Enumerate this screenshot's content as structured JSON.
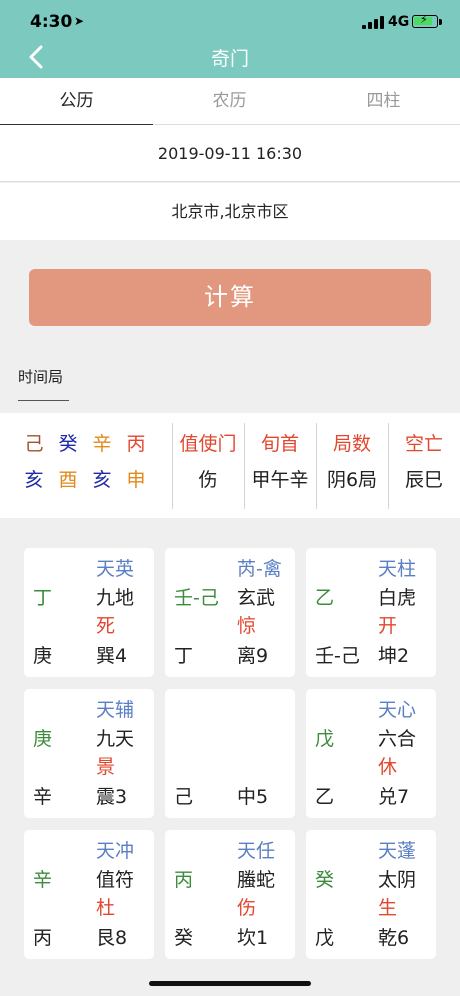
{
  "status_bar": {
    "time": "4:30",
    "location_icon": "location-arrow-icon",
    "network": "4G",
    "battery_icon": "battery-charging-icon"
  },
  "nav": {
    "title": "奇门",
    "back_icon": "chevron-left-icon"
  },
  "tabs": [
    {
      "label": "公历",
      "active": true
    },
    {
      "label": "农历",
      "active": false
    },
    {
      "label": "四柱",
      "active": false
    }
  ],
  "form": {
    "datetime": "2019-09-11 16:30",
    "location": "北京市,北京市区"
  },
  "calc_button": "计算",
  "section_label": "时间局",
  "pillars": {
    "stems": [
      {
        "text": "己",
        "color": "#a0522d"
      },
      {
        "text": "癸",
        "color": "#1f2aa8"
      },
      {
        "text": "辛",
        "color": "#e08a1e"
      },
      {
        "text": "丙",
        "color": "#e2472f"
      }
    ],
    "branches": [
      {
        "text": "亥",
        "color": "#1f2aa8"
      },
      {
        "text": "酉",
        "color": "#e08a1e"
      },
      {
        "text": "亥",
        "color": "#1f2aa8"
      },
      {
        "text": "申",
        "color": "#e08a1e"
      }
    ]
  },
  "info": [
    {
      "header": "值使门",
      "value": "伤"
    },
    {
      "header": "旬首",
      "value": "甲午辛"
    },
    {
      "header": "局数",
      "value": "阴6局"
    },
    {
      "header": "空亡",
      "value": "辰巳"
    }
  ],
  "palaces": [
    {
      "star": "天英",
      "left": "丁",
      "god": "九地",
      "door": "死",
      "earth": "庚",
      "palace": "巽4"
    },
    {
      "star": "芮-禽",
      "left": "壬-己",
      "god": "玄武",
      "door": "惊",
      "earth": "丁",
      "palace": "离9"
    },
    {
      "star": "天柱",
      "left": "乙",
      "god": "白虎",
      "door": "开",
      "earth": "壬-己",
      "palace": "坤2"
    },
    {
      "star": "天辅",
      "left": "庚",
      "god": "九天",
      "door": "景",
      "earth": "辛",
      "palace": "震3"
    },
    {
      "star": "",
      "left": "",
      "god": "",
      "door": "",
      "earth": "己",
      "palace": "中5"
    },
    {
      "star": "天心",
      "left": "戊",
      "god": "六合",
      "door": "休",
      "earth": "乙",
      "palace": "兑7"
    },
    {
      "star": "天冲",
      "left": "辛",
      "god": "值符",
      "door": "杜",
      "earth": "丙",
      "palace": "艮8"
    },
    {
      "star": "天任",
      "left": "丙",
      "god": "螣蛇",
      "door": "伤",
      "earth": "癸",
      "palace": "坎1"
    },
    {
      "star": "天蓬",
      "left": "癸",
      "god": "太阴",
      "door": "生",
      "earth": "戊",
      "palace": "乾6"
    }
  ],
  "colors": {
    "accent": "#7bc9bf",
    "button": "#e2987f",
    "star": "#5b7fc4",
    "stem": "#3c8c3c",
    "door": "#e2472f"
  }
}
